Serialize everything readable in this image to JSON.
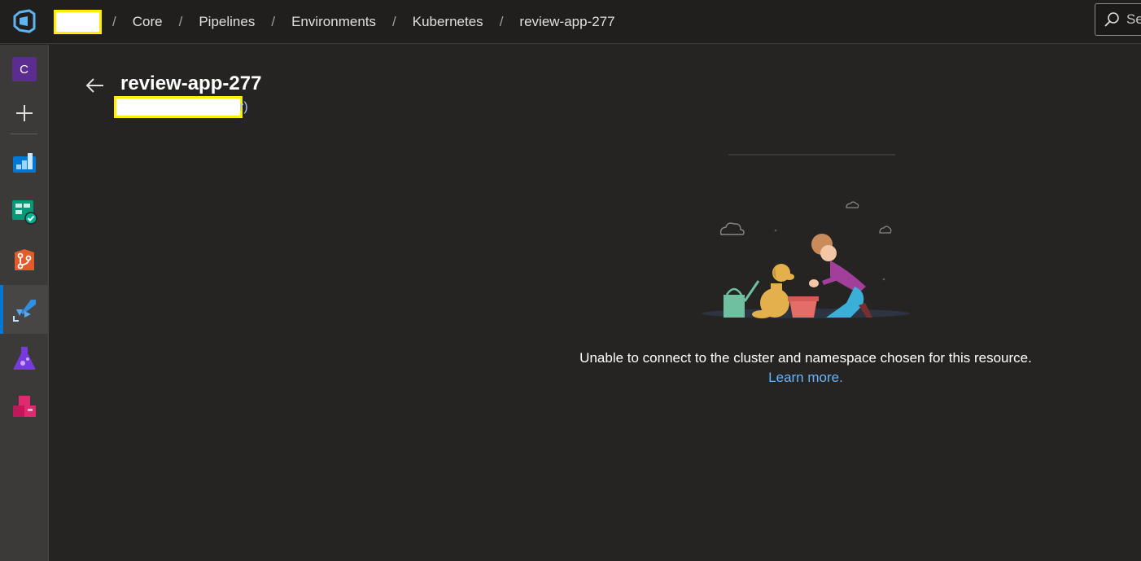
{
  "breadcrumb": {
    "items": [
      "Core",
      "Pipelines",
      "Environments",
      "Kubernetes",
      "review-app-277"
    ],
    "separator": "/"
  },
  "search": {
    "placeholder": "Se"
  },
  "sidenav": {
    "org_initial": "C",
    "items": [
      "overview-icon",
      "boards-icon",
      "repos-icon",
      "pipelines-icon",
      "test-plans-icon",
      "artifacts-icon"
    ],
    "active": "pipelines-icon",
    "accent": "#0078d4"
  },
  "page": {
    "title": "review-app-277",
    "subtitle_tail": "r)"
  },
  "empty_state": {
    "message": "Unable to connect to the cluster and namespace chosen for this resource.",
    "link": "Learn more."
  }
}
